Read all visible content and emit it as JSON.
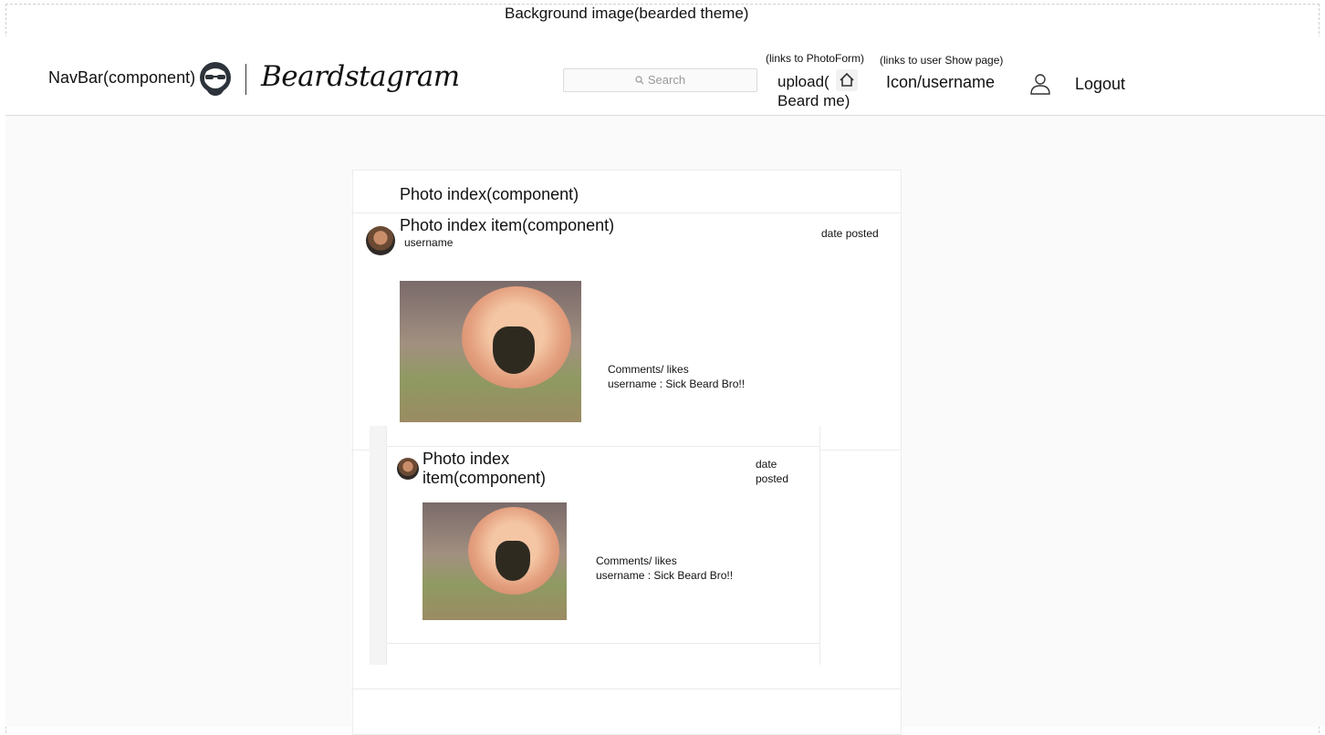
{
  "annotations": {
    "background": "Background image(bearded theme)",
    "navbar": "NavBar(component)",
    "photoform_link": "(links to PhotoForm)",
    "show_link": "(links to user Show page)"
  },
  "navbar": {
    "logo_text": "Beardstagram",
    "search_placeholder": "Search",
    "upload_label": "upload(",
    "beard_me_label": "Beard me)",
    "icon_username": "Icon/username",
    "logout_label": "Logout",
    "icons": [
      "bearded-face-logo-icon",
      "search-icon",
      "home-icon",
      "user-icon"
    ]
  },
  "photo_index": {
    "title": "Photo index(component)",
    "items": [
      {
        "title": "Photo index item(component)",
        "username": "username",
        "date": "date posted",
        "comments_header": "Comments/ likes",
        "comment": "username : Sick Beard Bro!!"
      },
      {
        "title_line1": "Photo index",
        "title_line2": "item(component)",
        "date_line1": "date",
        "date_line2": "posted",
        "comments_header": "Comments/ likes",
        "comment": "username : Sick Beard Bro!!"
      }
    ]
  }
}
